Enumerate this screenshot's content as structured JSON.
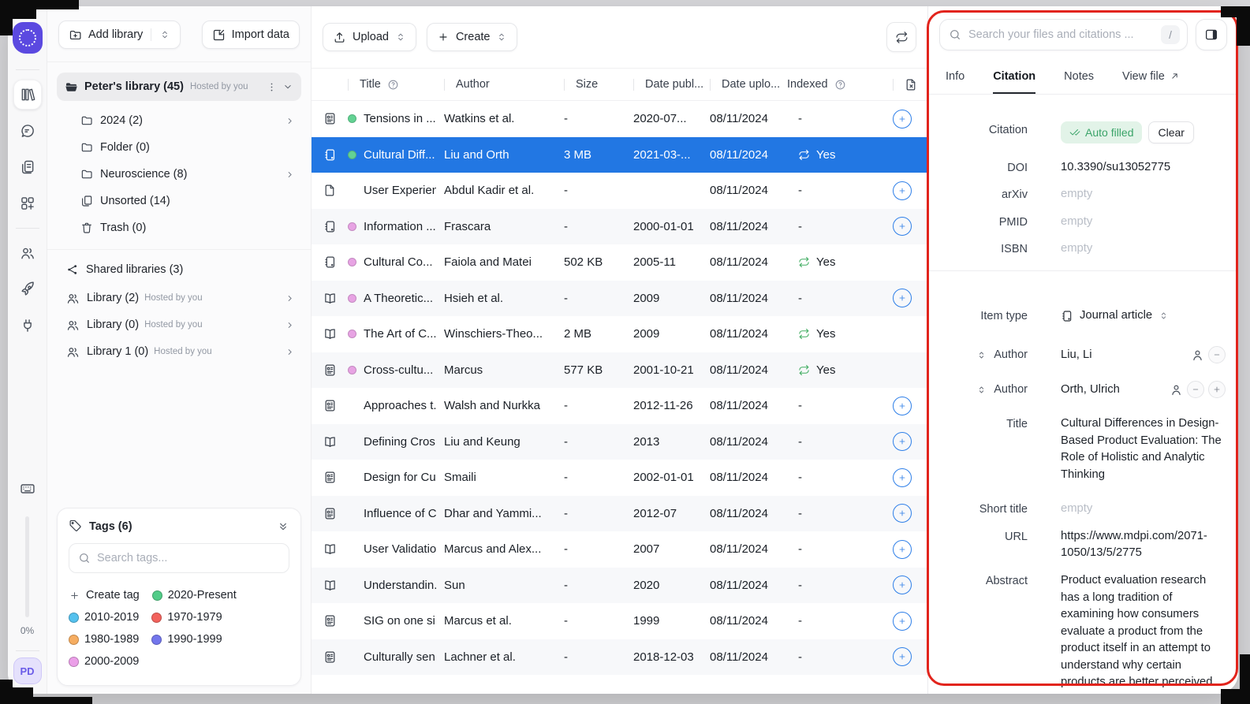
{
  "rail": {
    "icons": [
      "library",
      "chat",
      "notes",
      "apps",
      "people",
      "rocket",
      "plug",
      "keyboard"
    ],
    "progress_label": "0%",
    "avatar_initials": "PD"
  },
  "sidebar": {
    "add_library_label": "Add library",
    "import_data_label": "Import data",
    "library_name": "Peter's library (45)",
    "library_hosted": "Hosted by you",
    "folders": [
      {
        "icon": "folder",
        "label": "2024 (2)",
        "chevron": true
      },
      {
        "icon": "folder",
        "label": "Folder (0)",
        "chevron": false
      },
      {
        "icon": "folder",
        "label": "Neuroscience (8)",
        "chevron": true
      },
      {
        "icon": "stack",
        "label": "Unsorted (14)",
        "chevron": false
      },
      {
        "icon": "trash",
        "label": "Trash (0)",
        "chevron": false
      }
    ],
    "shared_header": "Shared libraries (3)",
    "shared_libraries": [
      {
        "label": "Library (2)",
        "hosted": "Hosted by you"
      },
      {
        "label": "Library (0)",
        "hosted": "Hosted by you"
      },
      {
        "label": "Library 1 (0)",
        "hosted": "Hosted by you"
      }
    ],
    "tags": {
      "header": "Tags (6)",
      "search_placeholder": "Search tags...",
      "create_label": "Create tag",
      "items": [
        {
          "label": "2020-Present",
          "color": "#52cc88"
        },
        {
          "label": "2010-2019",
          "color": "#54c1ee"
        },
        {
          "label": "1970-1979",
          "color": "#f2625c"
        },
        {
          "label": "1980-1989",
          "color": "#f6ad61"
        },
        {
          "label": "1990-1999",
          "color": "#7376ec"
        },
        {
          "label": "2000-2009",
          "color": "#eb9fe8"
        }
      ]
    }
  },
  "toolbar": {
    "upload_label": "Upload",
    "create_label": "Create"
  },
  "table": {
    "headers": {
      "title": "Title",
      "author": "Author",
      "size": "Size",
      "date_published": "Date publ...",
      "date_uploaded": "Date uplo...",
      "indexed": "Indexed"
    },
    "rows": [
      {
        "icon": "article",
        "dot": "#63d293",
        "title": "Tensions in ...",
        "author": "Watkins et al.",
        "size": "-",
        "published": "2020-07...",
        "uploaded": "08/11/2024",
        "indexed": "-",
        "indexed_yes": false,
        "add": true,
        "selected": false
      },
      {
        "icon": "journal",
        "dot": "#63d293",
        "title": "Cultural Diff...",
        "author": "Liu and Orth",
        "size": "3 MB",
        "published": "2021-03-...",
        "uploaded": "08/11/2024",
        "indexed": "Yes",
        "indexed_yes": true,
        "add": false,
        "selected": true
      },
      {
        "icon": "file",
        "dot": null,
        "title": "User Experien...",
        "author": "Abdul Kadir et al.",
        "size": "-",
        "published": "",
        "uploaded": "08/11/2024",
        "indexed": "-",
        "indexed_yes": false,
        "add": true,
        "selected": false
      },
      {
        "icon": "journal",
        "dot": "#e7a3e3",
        "title": "Information ...",
        "author": "Frascara",
        "size": "-",
        "published": "2000-01-01",
        "uploaded": "08/11/2024",
        "indexed": "-",
        "indexed_yes": false,
        "add": true,
        "selected": false
      },
      {
        "icon": "journal",
        "dot": "#e7a3e3",
        "title": "Cultural Co...",
        "author": "Faiola and Matei",
        "size": "502 KB",
        "published": "2005-11",
        "uploaded": "08/11/2024",
        "indexed": "Yes",
        "indexed_yes": true,
        "add": false,
        "selected": false
      },
      {
        "icon": "book",
        "dot": "#e7a3e3",
        "title": "A Theoretic...",
        "author": "Hsieh et al.",
        "size": "-",
        "published": "2009",
        "uploaded": "08/11/2024",
        "indexed": "-",
        "indexed_yes": false,
        "add": true,
        "selected": false
      },
      {
        "icon": "book",
        "dot": "#e7a3e3",
        "title": "The Art of C...",
        "author": "Winschiers-Theo...",
        "size": "2 MB",
        "published": "2009",
        "uploaded": "08/11/2024",
        "indexed": "Yes",
        "indexed_yes": true,
        "add": false,
        "selected": false
      },
      {
        "icon": "article",
        "dot": "#e7a3e3",
        "title": "Cross-cultu...",
        "author": "Marcus",
        "size": "577 KB",
        "published": "2001-10-21",
        "uploaded": "08/11/2024",
        "indexed": "Yes",
        "indexed_yes": true,
        "add": false,
        "selected": false
      },
      {
        "icon": "article",
        "dot": null,
        "title": "Approaches t...",
        "author": "Walsh and Nurkka",
        "size": "-",
        "published": "2012-11-26",
        "uploaded": "08/11/2024",
        "indexed": "-",
        "indexed_yes": false,
        "add": true,
        "selected": false
      },
      {
        "icon": "book",
        "dot": null,
        "title": "Defining Cros...",
        "author": "Liu and Keung",
        "size": "-",
        "published": "2013",
        "uploaded": "08/11/2024",
        "indexed": "-",
        "indexed_yes": false,
        "add": true,
        "selected": false
      },
      {
        "icon": "article",
        "dot": null,
        "title": "Design for Cu...",
        "author": "Smaili",
        "size": "-",
        "published": "2002-01-01",
        "uploaded": "08/11/2024",
        "indexed": "-",
        "indexed_yes": false,
        "add": true,
        "selected": false
      },
      {
        "icon": "article",
        "dot": null,
        "title": "Influence of C...",
        "author": "Dhar and Yammi...",
        "size": "-",
        "published": "2012-07",
        "uploaded": "08/11/2024",
        "indexed": "-",
        "indexed_yes": false,
        "add": true,
        "selected": false
      },
      {
        "icon": "book",
        "dot": null,
        "title": "User Validatio...",
        "author": "Marcus and Alex...",
        "size": "-",
        "published": "2007",
        "uploaded": "08/11/2024",
        "indexed": "-",
        "indexed_yes": false,
        "add": true,
        "selected": false
      },
      {
        "icon": "book",
        "dot": null,
        "title": "Understandin...",
        "author": "Sun",
        "size": "-",
        "published": "2020",
        "uploaded": "08/11/2024",
        "indexed": "-",
        "indexed_yes": false,
        "add": true,
        "selected": false
      },
      {
        "icon": "article",
        "dot": null,
        "title": "SIG on one si...",
        "author": "Marcus et al.",
        "size": "-",
        "published": "1999",
        "uploaded": "08/11/2024",
        "indexed": "-",
        "indexed_yes": false,
        "add": true,
        "selected": false
      },
      {
        "icon": "article",
        "dot": null,
        "title": "Culturally sen...",
        "author": "Lachner et al.",
        "size": "-",
        "published": "2018-12-03",
        "uploaded": "08/11/2024",
        "indexed": "-",
        "indexed_yes": false,
        "add": true,
        "selected": false
      }
    ]
  },
  "details": {
    "search_placeholder": "Search your files and citations ...",
    "shortcut": "/",
    "tabs": [
      {
        "label": "Info",
        "active": false,
        "external": false
      },
      {
        "label": "Citation",
        "active": true,
        "external": false
      },
      {
        "label": "Notes",
        "active": false,
        "external": false
      },
      {
        "label": "View file",
        "active": false,
        "external": true
      }
    ],
    "citation": {
      "label": "Citation",
      "badge": "Auto filled",
      "clear": "Clear",
      "fields": [
        {
          "label": "DOI",
          "value": "10.3390/su13052775",
          "is_empty": false
        },
        {
          "label": "arXiv",
          "value": "empty",
          "is_empty": true
        },
        {
          "label": "PMID",
          "value": "empty",
          "is_empty": true
        },
        {
          "label": "ISBN",
          "value": "empty",
          "is_empty": true
        }
      ]
    },
    "item": {
      "type_label": "Item type",
      "type_value": "Journal article",
      "authors": [
        {
          "label": "Author",
          "value": "Liu, Li",
          "has_add": false
        },
        {
          "label": "Author",
          "value": "Orth, Ulrich",
          "has_add": true
        }
      ],
      "title_label": "Title",
      "title_value": "Cultural Differences in Design-Based Product Evaluation: The Role of Holistic and Analytic Thinking",
      "short_title_label": "Short title",
      "short_title_value": "empty",
      "url_label": "URL",
      "url_value": "https://www.mdpi.com/2071-1050/13/5/2775",
      "abstract_label": "Abstract",
      "abstract_value": "Product evaluation research has a long tradition of examining how consumers evaluate a product from the product itself in an attempt to understand why certain products are better perceived"
    }
  },
  "colors": {
    "selected_row": "#2277e3",
    "accent_blue": "#2e7fe8",
    "indexed_green": "#43ae63",
    "annotation_red": "#e2241c"
  }
}
